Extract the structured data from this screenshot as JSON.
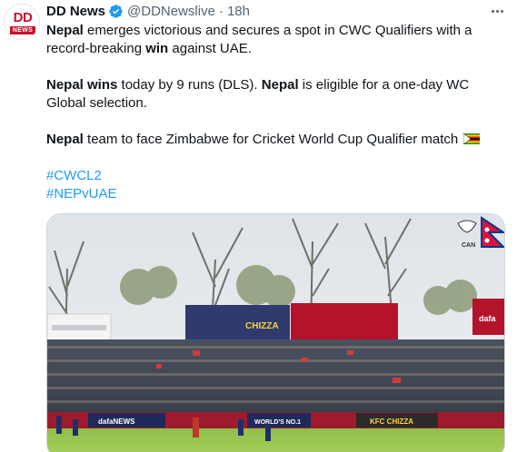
{
  "tweet": {
    "author": {
      "name": "DD News",
      "handle": "@DDNewslive",
      "avatar_text_top": "DD",
      "avatar_text_bottom": "NEWS",
      "verified": true
    },
    "separator": "·",
    "time": "18h",
    "paragraphs": [
      [
        {
          "text": "Nepal",
          "bold": true
        },
        {
          "text": " emerges victorious and secures a spot in CWC Qualifiers with a record-breaking ",
          "bold": false
        },
        {
          "text": "win",
          "bold": true
        },
        {
          "text": " against UAE.",
          "bold": false
        }
      ],
      [
        {
          "text": "Nepal wins",
          "bold": true
        },
        {
          "text": " today by 9 runs (DLS). ",
          "bold": false
        },
        {
          "text": "Nepal",
          "bold": true
        },
        {
          "text": " is eligible for a one-day WC Global selection.",
          "bold": false
        }
      ],
      [
        {
          "text": "Nepal",
          "bold": true
        },
        {
          "text": " team to face Zimbabwe for Cricket World Cup Qualifier match ",
          "bold": false
        }
      ]
    ],
    "hashtags": [
      "#CWCL2",
      "#NEPvUAE"
    ],
    "media": {
      "watermark_text": "CAN",
      "billboard_texts": [
        "CHIZZA",
        "dafa",
        "dafaNEWS",
        "WORLD'S NO.1",
        "KFC CHIZZA"
      ]
    },
    "icons": [
      "verified-badge-icon",
      "more-options-icon",
      "zimbabwe-flag-icon",
      "nepal-flag-icon"
    ],
    "colors": {
      "link": "#1d9bf0",
      "secondary_text": "#536471",
      "verified": "#1d9bf0",
      "brand_red": "#c8102e"
    }
  }
}
